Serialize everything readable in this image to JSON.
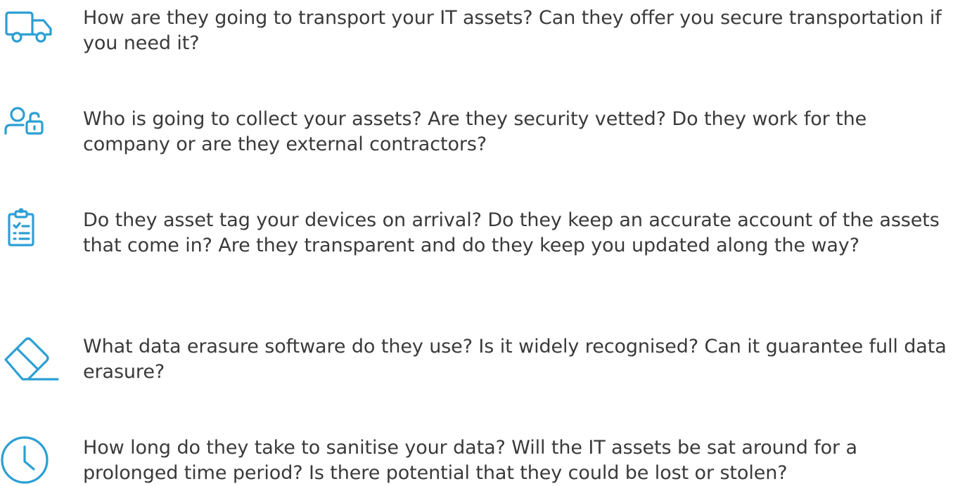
{
  "accent_color": "#2b9fd4",
  "text_color": "#3a3a3a",
  "items": [
    {
      "icon": "truck-icon",
      "text": "How are they going to transport your IT assets? Can they offer you secure transportation if you need it?"
    },
    {
      "icon": "user-lock-icon",
      "text": "Who is going to collect your assets? Are they security vetted? Do they work for the company or are they external contractors?"
    },
    {
      "icon": "clipboard-checklist-icon",
      "text": "Do they asset tag your devices on arrival? Do they keep an accurate account of the assets that come in? Are they transparent and do they keep you updated along the way?"
    },
    {
      "icon": "eraser-icon",
      "text": "What data erasure software do they use? Is it widely recognised? Can it guarantee full data erasure?"
    },
    {
      "icon": "clock-icon",
      "text": "How long do they take to sanitise your data? Will the IT assets be sat around for a prolonged time period? Is there potential that they could be lost or stolen?"
    }
  ]
}
